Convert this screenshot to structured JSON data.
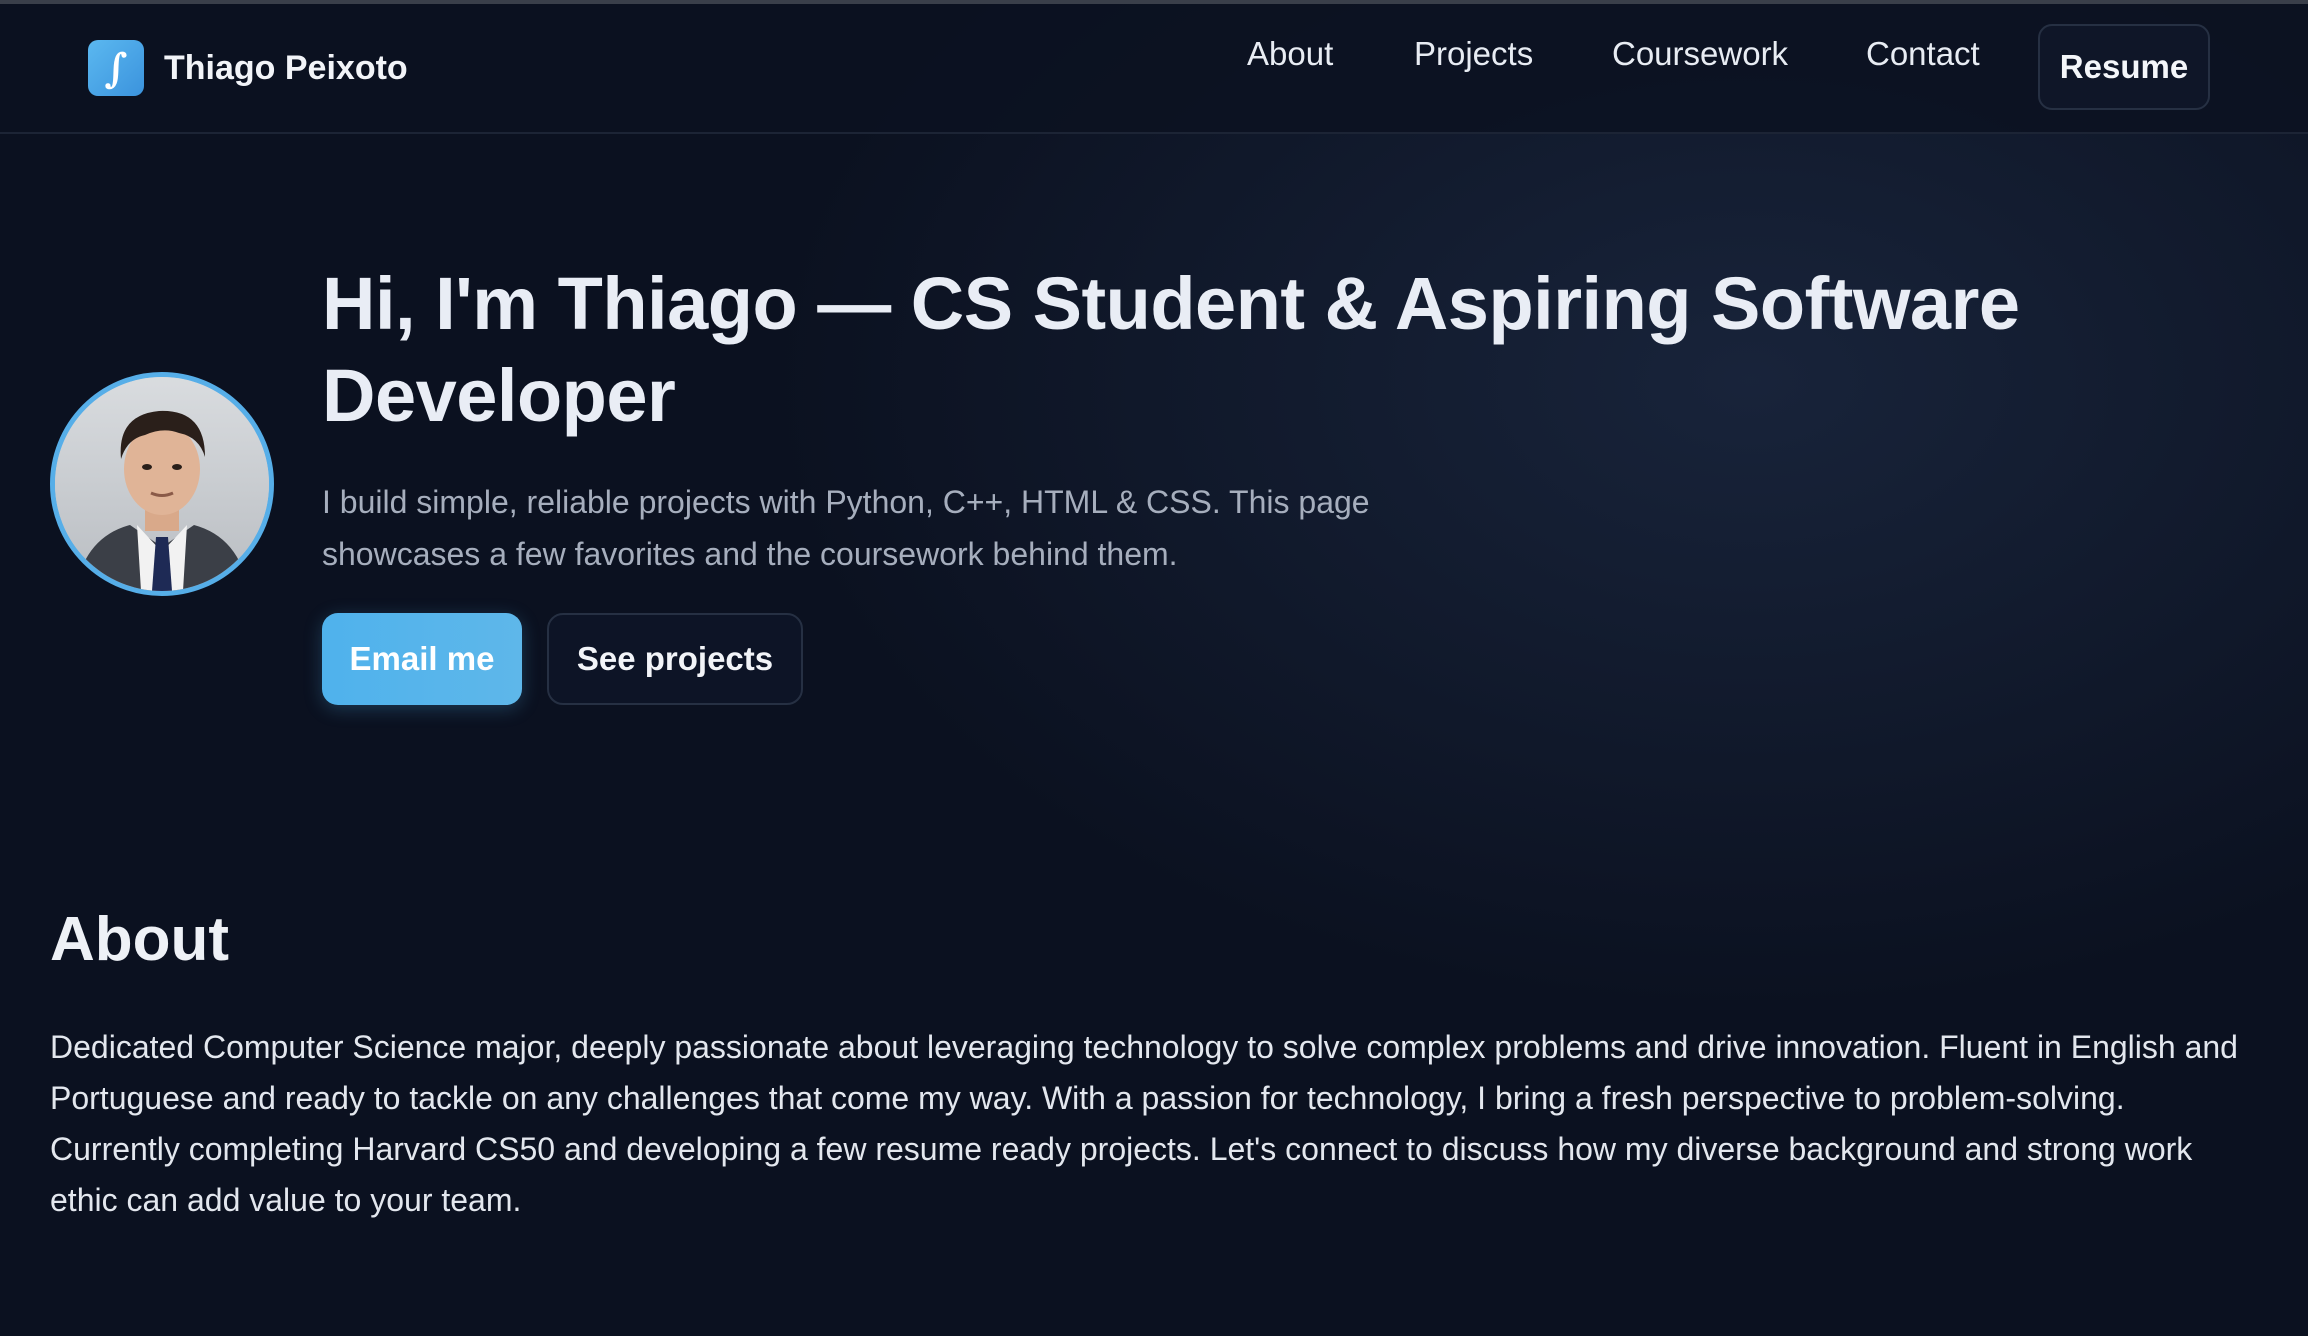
{
  "nav": {
    "brand_logo_glyph": "∫",
    "brand_name": "Thiago Peixoto",
    "links": [
      "About",
      "Projects",
      "Coursework",
      "Contact"
    ],
    "resume_label": "Resume"
  },
  "hero": {
    "title": "Hi, I'm Thiago — CS Student & Aspiring Software Developer",
    "subtitle": "I build simple, reliable projects with Python, C++, HTML & CSS. This page showcases a few favorites and the coursework behind them.",
    "email_button": "Email me",
    "projects_button": "See projects",
    "avatar_icon": "profile-photo"
  },
  "about": {
    "heading": "About",
    "body": "Dedicated Computer Science major, deeply passionate about leveraging technology to solve complex problems and drive innovation. Fluent in English and Portuguese and ready to tackle on any challenges that come my way. With a passion for technology, I bring a fresh perspective to problem-solving. Currently completing Harvard CS50 and developing a few resume ready projects. Let's connect to discuss how my diverse background and strong work ethic can add value to your team."
  },
  "colors": {
    "background": "#0b1120",
    "accent": "#4fb2ec",
    "text_primary": "#e9edf5",
    "text_muted": "#a6aebd"
  }
}
